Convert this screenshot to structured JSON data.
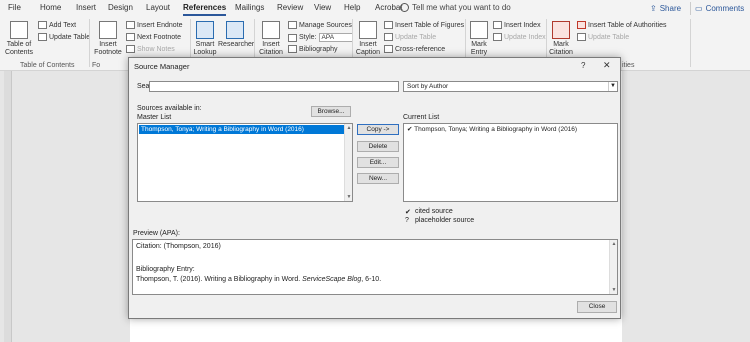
{
  "tabs": [
    "File",
    "Home",
    "Insert",
    "Design",
    "Layout",
    "References",
    "Mailings",
    "Review",
    "View",
    "Help",
    "Acrobat"
  ],
  "active_tab": "References",
  "tell_me": "Tell me what you want to do",
  "share_label": "Share",
  "comments_label": "Comments",
  "ribbon": {
    "table_of_contents": "Table of Contents",
    "add_text": "Add Text",
    "update_table": "Update Table",
    "group_toc": "Table of Contents",
    "group_footnotes_partial": "Fo",
    "insert_footnote": "Insert Footnote",
    "insert_endnote": "Insert Endnote",
    "next_footnote": "Next Footnote",
    "show_notes": "Show Notes",
    "smart_lookup": "Smart Lookup",
    "researcher": "Researcher",
    "insert_citation": "Insert Citation",
    "manage_sources": "Manage Sources",
    "style_label": "Style:",
    "style_value": "APA",
    "bibliography": "Bibliography",
    "insert_caption": "Insert Caption",
    "insert_table_of_figures": "Insert Table of Figures",
    "update_table_captions": "Update Table",
    "cross_reference": "Cross-reference",
    "mark_entry": "Mark Entry",
    "insert_index": "Insert Index",
    "update_index": "Update Index",
    "mark_citation": "Mark Citation",
    "insert_table_of_authorities": "Insert Table of Authorities",
    "update_table_authorities": "Update Table",
    "group_authorities_partial": "ities"
  },
  "dialog": {
    "title": "Source Manager",
    "help": "?",
    "close_x": "✕",
    "search_label": "Search:",
    "search_value": "",
    "sort_value": "Sort by Author",
    "sources_available_label": "Sources available in:",
    "master_list_label": "Master List",
    "browse_label": "Browse...",
    "current_list_label": "Current List",
    "master_items": [
      "Thompson, Tonya; Writing a Bibliography in Word (2016)"
    ],
    "current_items": [
      "✔ Thompson, Tonya; Writing a Bibliography in Word (2016)"
    ],
    "copy_label": "Copy ->",
    "delete_label": "Delete",
    "edit_label": "Edit...",
    "new_label": "New...",
    "legend_cited_mark": "✔",
    "legend_cited": "cited source",
    "legend_placeholder_mark": "?",
    "legend_placeholder": "placeholder source",
    "preview_label": "Preview (APA):",
    "preview_citation": "Citation:  (Thompson, 2016)",
    "preview_bib_heading": "Bibliography Entry:",
    "preview_bib_text_1": "Thompson, T. (2016). Writing a Bibliography in Word. ",
    "preview_bib_text_italic": "ServiceScape Blog",
    "preview_bib_text_2": ", 6-10.",
    "close_label": "Close"
  },
  "colors": {
    "accent": "#2b579a",
    "selection": "#0078d7"
  }
}
